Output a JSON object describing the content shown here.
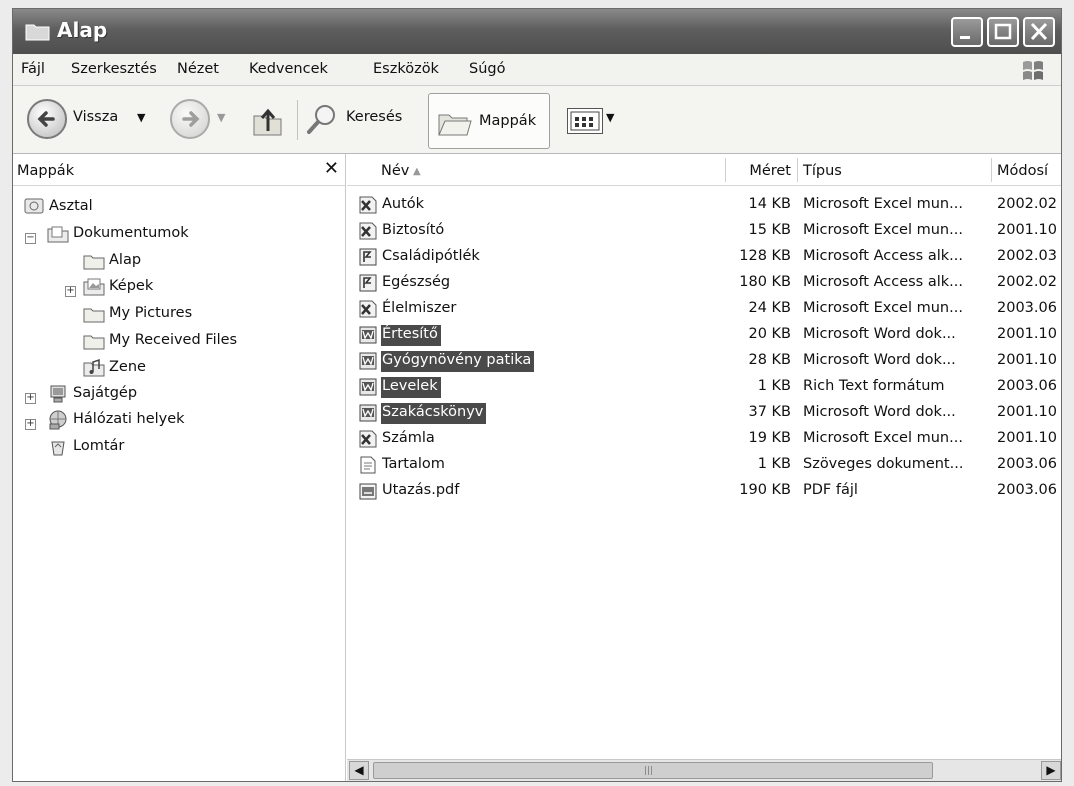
{
  "window": {
    "title": "Alap"
  },
  "menu": [
    "Fájl",
    "Szerkesztés",
    "Nézet",
    "Kedvencek",
    "Eszközök",
    "Súgó"
  ],
  "toolbar": {
    "back_label": "Vissza",
    "search_label": "Keresés",
    "folders_label": "Mappák"
  },
  "folders_pane": {
    "title": "Mappák",
    "close_glyph": "✕",
    "tree": [
      {
        "label": "Asztal",
        "icon": "desktop-icon"
      },
      {
        "label": "Dokumentumok",
        "icon": "documents-folder-icon",
        "expander": "−"
      },
      {
        "label": "Alap",
        "icon": "folder-icon"
      },
      {
        "label": "Képek",
        "icon": "pictures-folder-icon",
        "expander": "+"
      },
      {
        "label": "My Pictures",
        "icon": "folder-icon"
      },
      {
        "label": "My Received Files",
        "icon": "folder-icon"
      },
      {
        "label": "Zene",
        "icon": "music-folder-icon"
      },
      {
        "label": "Sajátgép",
        "icon": "my-computer-icon",
        "expander": "+"
      },
      {
        "label": "Hálózati helyek",
        "icon": "network-places-icon",
        "expander": "+"
      },
      {
        "label": "Lomtár",
        "icon": "recycle-bin-icon"
      }
    ]
  },
  "file_list": {
    "columns": [
      "Név",
      "Méret",
      "Típus",
      "Módosí"
    ],
    "rows": [
      {
        "name": "Autók",
        "size": "14 KB",
        "type": "Microsoft Excel mun...",
        "modified": "2002.02",
        "icon": "excel-file-icon",
        "selected": false
      },
      {
        "name": "Biztosító",
        "size": "15 KB",
        "type": "Microsoft Excel mun...",
        "modified": "2001.10",
        "icon": "excel-file-icon",
        "selected": false
      },
      {
        "name": "Családipótlék",
        "size": "128 KB",
        "type": "Microsoft Access alk...",
        "modified": "2002.03",
        "icon": "access-file-icon",
        "selected": false
      },
      {
        "name": "Egészség",
        "size": "180 KB",
        "type": "Microsoft Access alk...",
        "modified": "2002.02",
        "icon": "access-file-icon",
        "selected": false
      },
      {
        "name": "Élelmiszer",
        "size": "24 KB",
        "type": "Microsoft Excel mun...",
        "modified": "2003.06",
        "icon": "excel-file-icon",
        "selected": false
      },
      {
        "name": "Értesítő",
        "size": "20 KB",
        "type": "Microsoft Word dok...",
        "modified": "2001.10",
        "icon": "word-file-icon",
        "selected": true
      },
      {
        "name": "Gyógynövény patika",
        "size": "28 KB",
        "type": "Microsoft Word dok...",
        "modified": "2001.10",
        "icon": "word-file-icon",
        "selected": true
      },
      {
        "name": "Levelek",
        "size": "1 KB",
        "type": "Rich Text formátum",
        "modified": "2003.06",
        "icon": "word-file-icon",
        "selected": true
      },
      {
        "name": "Szakácskönyv",
        "size": "37 KB",
        "type": "Microsoft Word dok...",
        "modified": "2001.10",
        "icon": "word-file-icon",
        "selected": true
      },
      {
        "name": "Számla",
        "size": "19 KB",
        "type": "Microsoft Excel mun...",
        "modified": "2001.10",
        "icon": "excel-file-icon",
        "selected": false
      },
      {
        "name": "Tartalom",
        "size": "1 KB",
        "type": "Szöveges dokument...",
        "modified": "2003.06",
        "icon": "text-file-icon",
        "selected": false
      },
      {
        "name": "Utazás.pdf",
        "size": "190 KB",
        "type": "PDF fájl",
        "modified": "2003.06",
        "icon": "pdf-file-icon",
        "selected": false
      }
    ]
  }
}
